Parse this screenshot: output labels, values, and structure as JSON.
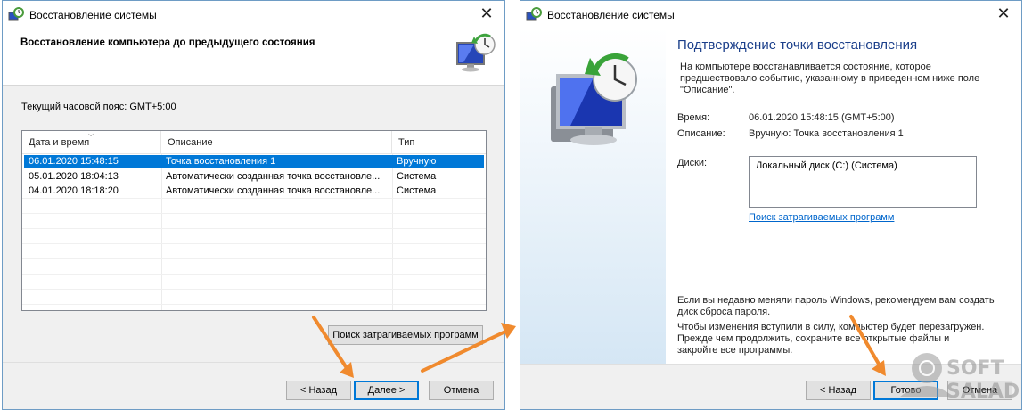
{
  "left_dialog": {
    "title": "Восстановление системы",
    "heading": "Восстановление компьютера до предыдущего состояния",
    "timezone": "Текущий часовой пояс: GMT+5:00",
    "columns": [
      "Дата и время",
      "Описание",
      "Тип"
    ],
    "rows": [
      {
        "date": "06.01.2020 15:48:15",
        "desc": "Точка восстановления 1",
        "type": "Вручную"
      },
      {
        "date": "05.01.2020 18:04:13",
        "desc": "Автоматически созданная точка восстановле...",
        "type": "Система"
      },
      {
        "date": "04.01.2020 18:18:20",
        "desc": "Автоматически созданная точка восстановле...",
        "type": "Система"
      }
    ],
    "scan_button": "Поиск затрагиваемых программ",
    "back_button": "< Назад",
    "next_button": "Далее >",
    "cancel_button": "Отмена"
  },
  "right_dialog": {
    "title": "Восстановление системы",
    "heading": "Подтверждение точки восстановления",
    "intro": [
      "На компьютере восстанавливается состояние, которое",
      "предшествовало событию, указанному в приведенном ниже поле",
      "\"Описание\"."
    ],
    "time_label": "Время:",
    "time_value": "06.01.2020 15:48:15 (GMT+5:00)",
    "desc_label": "Описание:",
    "desc_value": "Вручную: Точка восстановления 1",
    "disks_label": "Диски:",
    "disks_value": "Локальный диск (C:) (Система)",
    "scan_link": "Поиск затрагиваемых программ",
    "password_note": [
      "Если вы недавно меняли пароль Windows, рекомендуем вам создать",
      "диск сброса пароля."
    ],
    "restart_note": [
      "Чтобы изменения вступили в силу, компьютер будет перезагружен.",
      "Прежде чем продолжить, сохраните все открытые файлы и",
      "закройте все программы."
    ],
    "back_button": "< Назад",
    "finish_button": "Готово",
    "cancel_button": "Отмена"
  },
  "watermark": {
    "line1": "SOFT",
    "line2": "SALAD"
  },
  "colors": {
    "accent": "#0078d7",
    "arrow": "#f08a2e",
    "heading_blue": "#1a3e8a",
    "link": "#0066cc"
  }
}
